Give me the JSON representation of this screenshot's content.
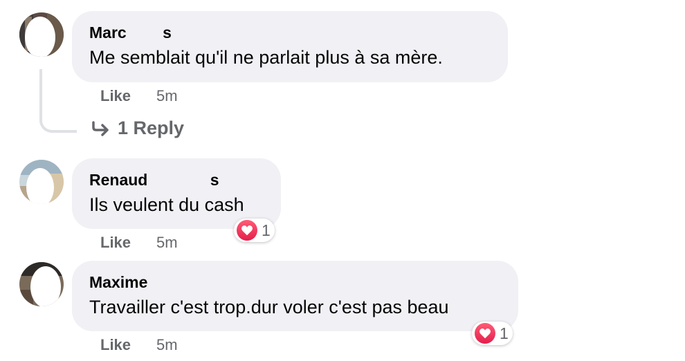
{
  "comments": [
    {
      "author": "Marc ",
      "author_suffix": "s",
      "text": "Me semblait qu'il ne parlait plus à sa mère.",
      "like_label": "Like",
      "time": "5m",
      "reply_label": "1 Reply"
    },
    {
      "author": "Renaud ",
      "author_suffix": "s",
      "text": "Ils veulent du cash",
      "like_label": "Like",
      "time": "5m",
      "reaction": {
        "icon": "heart-icon",
        "count": "1"
      }
    },
    {
      "author": "Maxime",
      "text": "Travailler c'est trop.dur voler c'est pas beau",
      "like_label": "Like",
      "time": "5m",
      "reaction": {
        "icon": "heart-icon",
        "count": "1"
      }
    }
  ],
  "colors": {
    "bubble": "#f0f0f5",
    "meta": "#65676b",
    "heart": "#e41e4c"
  }
}
